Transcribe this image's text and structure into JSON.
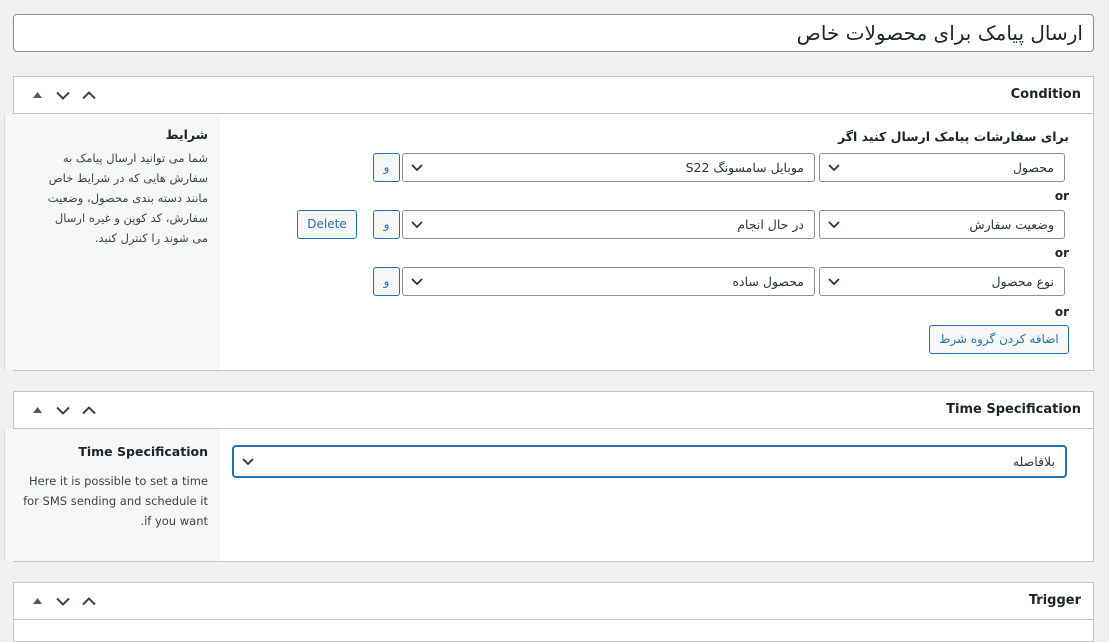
{
  "post_title": "ارسال پیامک برای محصولات خاص",
  "condition_box": {
    "title": "Condition",
    "side_heading": "شرایط",
    "side_lines": [
      "شما می توانید ارسال پیامک به",
      "سفارش هایی که در شرایط خاص",
      "مانند دسته بندی محصول، وضعیت",
      "سفارش، کد کوپن و غیره ارسال",
      "می شوند را کنترل کنید."
    ],
    "intro_label": "برای سفارشات پیامک ارسال کنید اگر",
    "rows": [
      {
        "field": "محصول",
        "value": "موبایل سامسونگ S22",
        "and_label": "و"
      },
      {
        "field": "وضعیت سفارش",
        "value": "در حال انجام",
        "and_label": "و"
      },
      {
        "field": "نوع محصول",
        "value": "محصول ساده",
        "and_label": "و"
      }
    ],
    "or_label": "or",
    "delete_label": "Delete",
    "add_group_label": "اضافه کردن گروه شرط"
  },
  "time_box": {
    "title": "Time Specification",
    "side_heading": "Time Specification",
    "side_lines": [
      "Here it is possible to set a time",
      "for SMS sending and schedule it",
      "if you want."
    ],
    "select_value": "بلافاصله"
  },
  "trigger_box": {
    "title": "Trigger"
  },
  "icons": {
    "handle_up": "triangle-up-icon",
    "move_down": "chevron-down-icon",
    "move_up": "chevron-up-icon",
    "select_arrow": "chevron-down-icon"
  },
  "colors": {
    "accent": "#2271b1",
    "focus_border": "#2271b1"
  }
}
